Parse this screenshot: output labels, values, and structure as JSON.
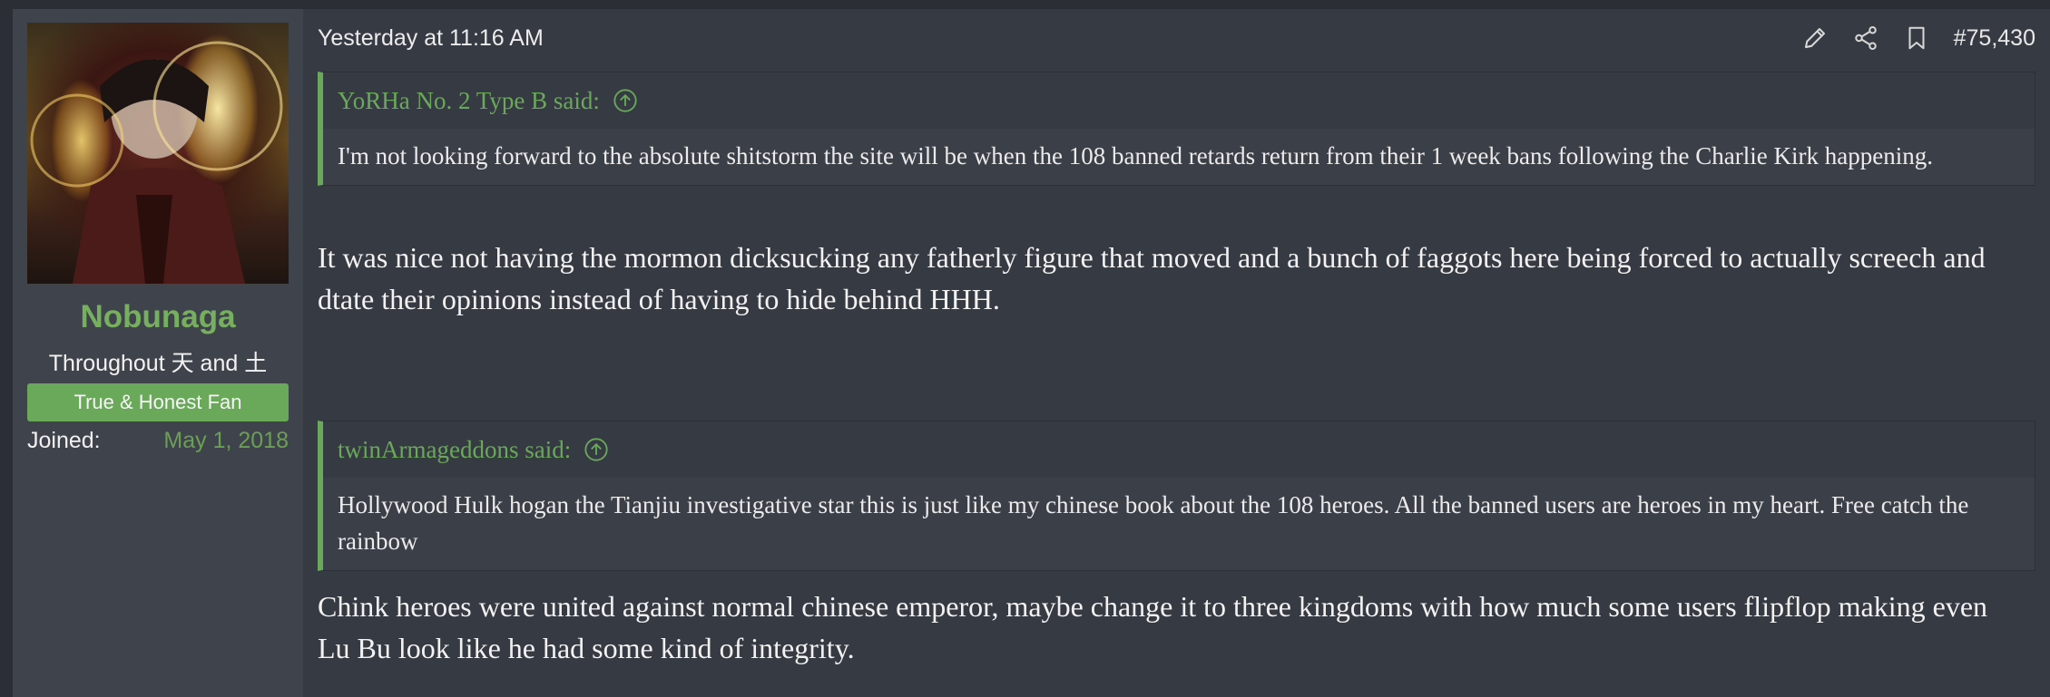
{
  "user": {
    "name": "Nobunaga",
    "title": "Throughout 天 and 土",
    "banner": "True & Honest Fan",
    "joined_label": "Joined:",
    "joined_value": "May 1, 2018"
  },
  "post": {
    "date": "Yesterday at 11:16 AM",
    "number": "#75,430",
    "icons": [
      "edit-pencil-icon",
      "share-icon",
      "bookmark-icon"
    ]
  },
  "quote1": {
    "author": "YoRHa No. 2 Type B said:",
    "text": "I'm not looking forward to the absolute shitstorm the site will be when the 108 banned retards return from their 1 week bans following the Charlie Kirk happening."
  },
  "reply1": "It was nice not having the mormon dicksucking any fatherly figure that moved and a bunch of faggots here being forced to actually screech and dtate their opinions instead of having to hide behind HHH.",
  "quote2": {
    "author": "twinArmageddons said:",
    "text": "Hollywood Hulk hogan the Tianjiu investigative star this is just like my chinese book about the 108 heroes. All the banned users are heroes in my heart. Free catch the rainbow"
  },
  "reply2": "Chink heroes were united against normal chinese emperor, maybe change it to three kingdoms with how much some users flipflop making even Lu Bu look like he had some kind of integrity.",
  "colors": {
    "accent_green": "#6aa85a",
    "username_green": "#76b05e",
    "background": "#363a43",
    "sidebar": "#3f434c"
  }
}
